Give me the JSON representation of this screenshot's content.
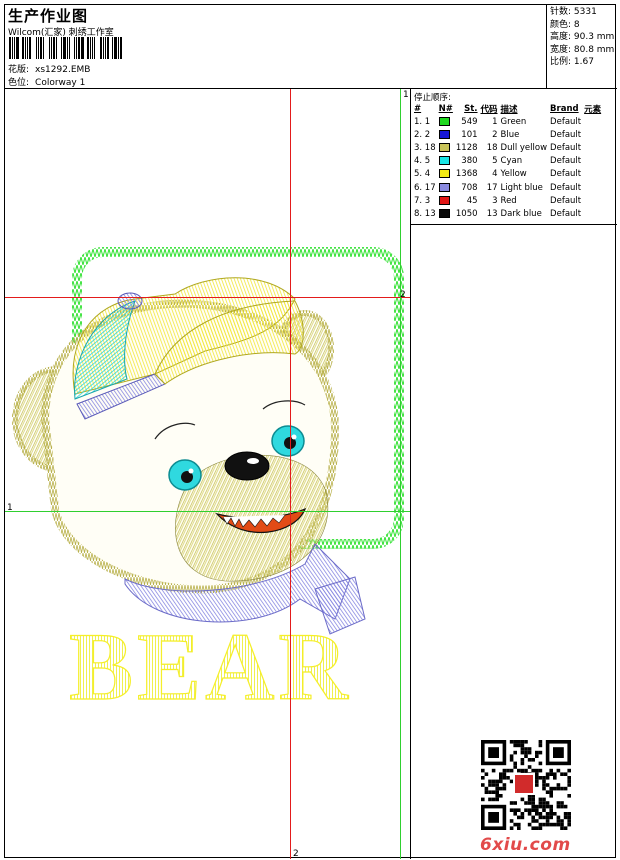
{
  "header": {
    "title": "生产作业图",
    "company": "Wilcom(汇家) 刺绣工作室",
    "pattern_label": "花版:",
    "pattern_value": "xs1292.EMB",
    "colorway_label": "色位:",
    "colorway_value": "Colorway 1"
  },
  "stats": {
    "stitches": "针数: 5331",
    "colors": "颜色: 8",
    "height": "高度: 90.3 mm",
    "width": "宽度: 80.8 mm",
    "ratio": "比例: 1.67"
  },
  "color_table": {
    "stop_title": "停止顺序:",
    "headers": [
      "#",
      "N#",
      "St.",
      "代码",
      "描述",
      "Brand",
      "元素"
    ],
    "rows": [
      {
        "idx": "1. 1",
        "color": "#1fd81f",
        "st": "549",
        "code": "1",
        "desc": "Green",
        "brand": "Default"
      },
      {
        "idx": "2. 2",
        "color": "#1717d8",
        "st": "101",
        "code": "2",
        "desc": "Blue",
        "brand": "Default"
      },
      {
        "idx": "3. 18",
        "color": "#c9c45a",
        "st": "1128",
        "code": "18",
        "desc": "Dull yellow",
        "brand": "Default"
      },
      {
        "idx": "4. 5",
        "color": "#19e6e6",
        "st": "380",
        "code": "5",
        "desc": "Cyan",
        "brand": "Default"
      },
      {
        "idx": "5. 4",
        "color": "#f2ea14",
        "st": "1368",
        "code": "4",
        "desc": "Yellow",
        "brand": "Default"
      },
      {
        "idx": "6. 17",
        "color": "#8a8ae0",
        "st": "708",
        "code": "17",
        "desc": "Light blue",
        "brand": "Default"
      },
      {
        "idx": "7. 3",
        "color": "#e21616",
        "st": "45",
        "code": "3",
        "desc": "Red",
        "brand": "Default"
      },
      {
        "idx": "8. 13",
        "color": "#0a0a0a",
        "st": "1050",
        "code": "13",
        "desc": "Dark blue",
        "brand": "Default"
      }
    ]
  },
  "guides": {
    "red_v_label": "2",
    "red_h_label": "2",
    "green_h_label": "1",
    "green_v_label": "1"
  },
  "artwork": {
    "text": "BEAR"
  },
  "watermark": "6xiu.com"
}
